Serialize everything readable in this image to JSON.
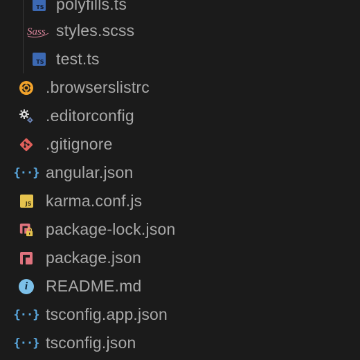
{
  "colors": {
    "background": "#1b1b1b",
    "text": "#a9a9a9",
    "ts_blue": "#3c69b3",
    "sass_pink": "#d9849b",
    "browserslist_orange": "#f2a32b",
    "git_red": "#e0605b",
    "json_blue": "#5aa8df",
    "js_yellow": "#e6c34e",
    "npm_red": "#e0737e",
    "info_blue": "#7cc0e8",
    "lock_yellow": "#e6c34e"
  },
  "explorer": {
    "nested_files": [
      {
        "name": "polyfills.ts",
        "icon": "typescript-icon"
      },
      {
        "name": "styles.scss",
        "icon": "sass-icon",
        "icon_text": "Sass"
      },
      {
        "name": "test.ts",
        "icon": "typescript-icon"
      }
    ],
    "root_files": [
      {
        "name": ".browserslistrc",
        "icon": "browserslist-icon"
      },
      {
        "name": ".editorconfig",
        "icon": "editorconfig-gears-icon"
      },
      {
        "name": ".gitignore",
        "icon": "git-icon"
      },
      {
        "name": "angular.json",
        "icon": "json-braces-icon"
      },
      {
        "name": "karma.conf.js",
        "icon": "javascript-icon"
      },
      {
        "name": "package-lock.json",
        "icon": "npm-lock-icon"
      },
      {
        "name": "package.json",
        "icon": "npm-icon"
      },
      {
        "name": "README.md",
        "icon": "info-icon"
      },
      {
        "name": "tsconfig.app.json",
        "icon": "json-braces-icon"
      },
      {
        "name": "tsconfig.json",
        "icon": "json-braces-icon"
      }
    ],
    "badge_text": {
      "ts": "TS",
      "js": "JS",
      "json": "{··}",
      "info": "i"
    }
  }
}
